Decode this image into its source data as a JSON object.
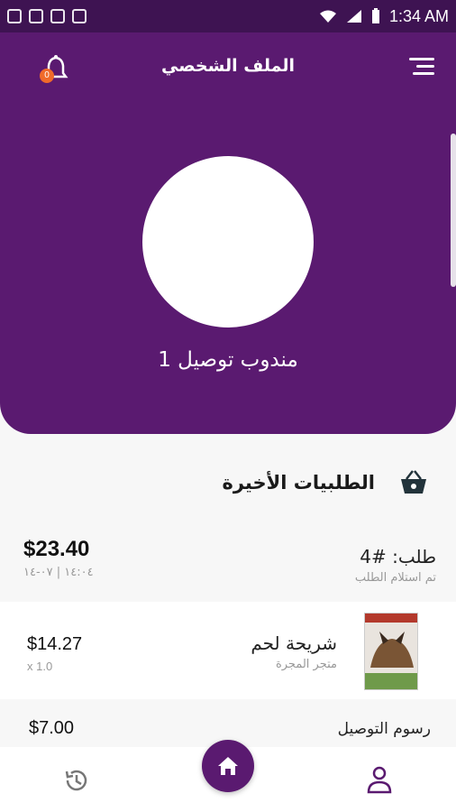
{
  "status_bar": {
    "time": "1:34 AM"
  },
  "header": {
    "title": "الملف الشخصي",
    "notification_count": "0",
    "driver_name": "مندوب توصيل 1"
  },
  "recent_orders": {
    "title": "الطلبيات الأخيرة",
    "order": {
      "number_label": "طلب: #4",
      "status": "تم استلام الطلب",
      "total": "$23.40",
      "date": "١٤:٠٤ | ٠٧-١٤"
    },
    "item": {
      "name": "شريحة لحم",
      "store": "متجر المجرة",
      "price": "$14.27",
      "quantity": "x 1.0"
    },
    "delivery_fee": {
      "label": "رسوم التوصيل",
      "price": "$7.00"
    }
  },
  "colors": {
    "primary": "#5a1a70",
    "badge": "#f06a2a"
  },
  "icons": {
    "menu": "menu-icon",
    "notifications": "bell-icon",
    "basket": "basket-icon",
    "history": "history-icon",
    "home": "home-icon",
    "profile": "profile-icon"
  }
}
